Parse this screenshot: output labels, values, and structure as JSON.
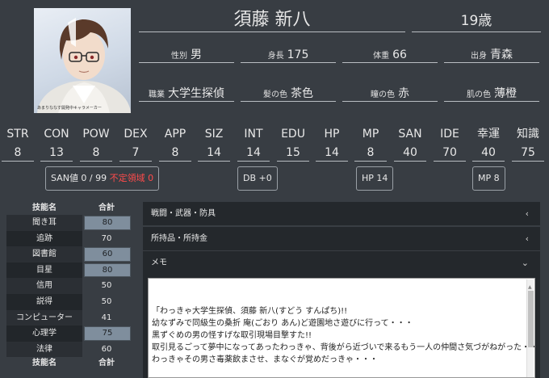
{
  "character": {
    "name": "須藤 新八",
    "age": "19歳",
    "avatar_caption": "あまりななす開発中キャラメーカー"
  },
  "profile_row1": [
    {
      "label": "性別",
      "value": "男"
    },
    {
      "label": "身長",
      "value": "175"
    },
    {
      "label": "体重",
      "value": "66"
    },
    {
      "label": "出身",
      "value": "青森"
    }
  ],
  "profile_row2": [
    {
      "label": "職業",
      "value": "大学生探偵"
    },
    {
      "label": "髪の色",
      "value": "茶色"
    },
    {
      "label": "瞳の色",
      "value": "赤"
    },
    {
      "label": "肌の色",
      "value": "薄橙"
    }
  ],
  "stats": [
    {
      "label": "STR",
      "value": "8"
    },
    {
      "label": "CON",
      "value": "13"
    },
    {
      "label": "POW",
      "value": "8"
    },
    {
      "label": "DEX",
      "value": "7"
    },
    {
      "label": "APP",
      "value": "8"
    },
    {
      "label": "SIZ",
      "value": "14"
    },
    {
      "label": "INT",
      "value": "14"
    },
    {
      "label": "EDU",
      "value": "15"
    },
    {
      "label": "HP",
      "value": "14"
    },
    {
      "label": "MP",
      "value": "8"
    },
    {
      "label": "SAN",
      "value": "40"
    },
    {
      "label": "IDE",
      "value": "70"
    },
    {
      "label": "幸運",
      "value": "40"
    },
    {
      "label": "知識",
      "value": "75"
    }
  ],
  "summary": {
    "san": "SAN値 0 / 99",
    "san_warning": "不定領域 0",
    "db": "DB +0",
    "hp": "HP 14",
    "mp": "MP 8"
  },
  "skills": {
    "header_name": "技能名",
    "header_total": "合計",
    "rows": [
      {
        "name": "聞き耳",
        "total": "80"
      },
      {
        "name": "追跡",
        "total": "70"
      },
      {
        "name": "図書館",
        "total": "60"
      },
      {
        "name": "目星",
        "total": "80"
      },
      {
        "name": "信用",
        "total": "50"
      },
      {
        "name": "説得",
        "total": "50"
      },
      {
        "name": "コンピューター",
        "total": "41"
      },
      {
        "name": "心理学",
        "total": "75"
      },
      {
        "name": "法律",
        "total": "60"
      }
    ]
  },
  "sections": {
    "combat": "戦闘・武器・防具",
    "items": "所持品・所持金",
    "memo": "メモ"
  },
  "memo_text": "「わっきゃ大学生探偵、須藤 新八(すどう すんぱち)!!\n幼なずみで同級生の桑折 庵(ごおり あん)ど遊園地さ遊びに行って・・・\n黒ずぐめの男の怪すげな取引現場目撃すた!!\n取引見るごって夢中になってあったわっきゃ、背後がら近づいで来るもう一人の仲間さ気づがねがった・・・\nわっきゃその男さ毒薬飲まさせ、まなぐが覚めだっきゃ・・・\n\nいぢげやぐが棺さ入ってあった!!」",
  "colors": {
    "background": "#383d43",
    "panel": "#24282c",
    "skill_value": "#7f8e9d",
    "warning": "#ff4b4b"
  }
}
